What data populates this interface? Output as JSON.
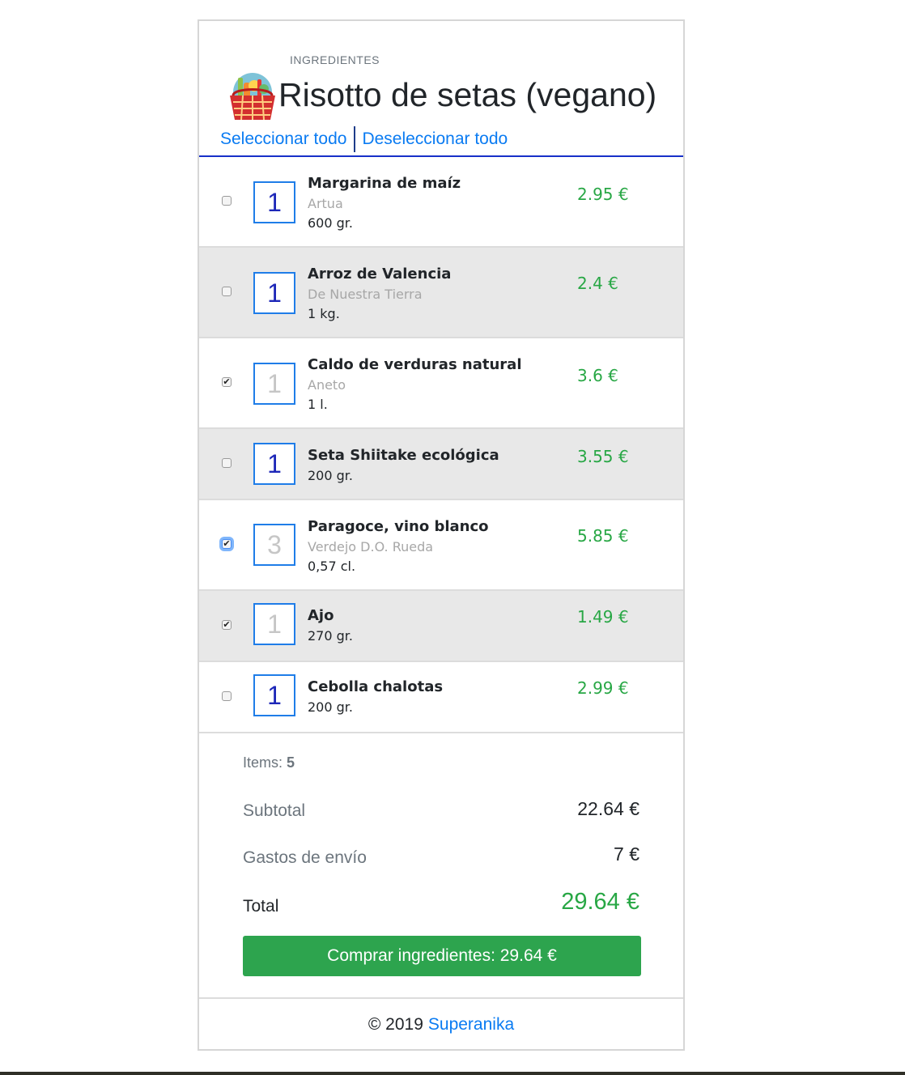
{
  "header": {
    "subtitle": "INGREDIENTES",
    "title": "Risotto de setas (vegano)",
    "basket_icon": "shopping-basket-icon",
    "select_all": "Seleccionar todo",
    "deselect_all": "Deseleccionar todo"
  },
  "items": [
    {
      "name": "Margarina de maíz",
      "brand": "Artua",
      "size": "600 gr.",
      "quantity": "1",
      "price": "2.95 €",
      "checked": false
    },
    {
      "name": "Arroz de Valencia",
      "brand": "De Nuestra Tierra",
      "size": "1 kg.",
      "quantity": "1",
      "price": "2.4 €",
      "checked": false
    },
    {
      "name": "Caldo de verduras natural",
      "brand": "Aneto",
      "size": "1 l.",
      "quantity": "1",
      "price": "3.6 €",
      "checked": true
    },
    {
      "name": "Seta Shiitake ecológica",
      "brand": "",
      "size": "200 gr.",
      "quantity": "1",
      "price": "3.55 €",
      "checked": false
    },
    {
      "name": "Paragoce, vino blanco",
      "brand": "Verdejo D.O. Rueda",
      "size": "0,57 cl.",
      "quantity": "3",
      "price": "5.85 €",
      "checked": true
    },
    {
      "name": "Ajo",
      "brand": "",
      "size": "270 gr.",
      "quantity": "1",
      "price": "1.49 €",
      "checked": true
    },
    {
      "name": "Cebolla chalotas",
      "brand": "",
      "size": "200 gr.",
      "quantity": "1",
      "price": "2.99 €",
      "checked": false
    }
  ],
  "summary": {
    "items_label": "Items:",
    "items_count": "5",
    "subtotal_label": "Subtotal",
    "subtotal_value": "22.64 €",
    "shipping_label": "Gastos de envío",
    "shipping_value": "7 €",
    "total_label": "Total",
    "total_value": "29.64 €",
    "buy_button": "Comprar ingredientes: 29.64 €"
  },
  "footer": {
    "copyright": "© 2019",
    "link": "Superanika"
  },
  "colors": {
    "accent_blue": "#0a7bf2",
    "price_green": "#28a745",
    "button_green": "#2da44e",
    "row_alt": "#e8e8e8"
  }
}
